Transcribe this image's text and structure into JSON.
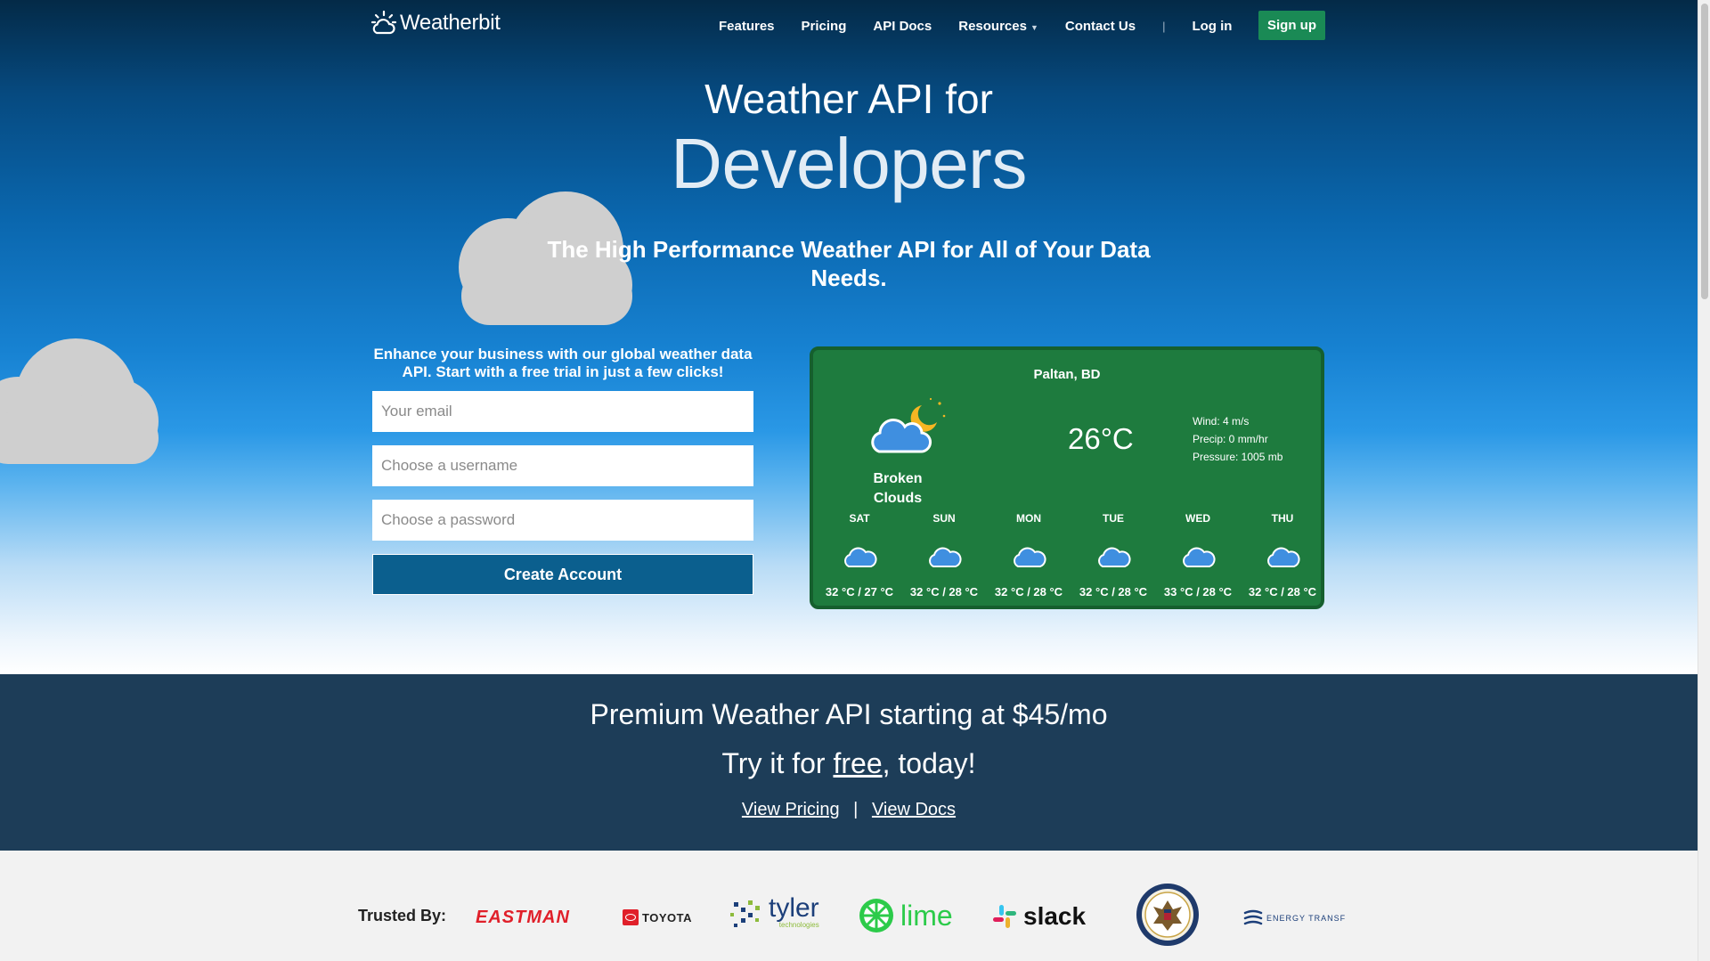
{
  "nav": {
    "brand": "Weatherbit",
    "links": [
      "Features",
      "Pricing",
      "API Docs",
      "Resources",
      "Contact Us"
    ],
    "separator": "|",
    "login": "Log in",
    "signup": "Sign up"
  },
  "hero": {
    "title_line1": "Weather API for",
    "title_line2": "Developers",
    "subtitle": "The High Performance Weather API for All of Your Data Needs."
  },
  "signup_form": {
    "pitch": "Enhance your business with our global weather data API. Start with a free trial in just a few clicks!",
    "email_placeholder": "Your email",
    "username_placeholder": "Choose a username",
    "password_placeholder": "Choose a password",
    "submit_label": "Create Account"
  },
  "weather_widget": {
    "location": "Paltan, BD",
    "condition": "Broken Clouds",
    "temperature": "26°C",
    "wind": "Wind: 4 m/s",
    "precip": "Precip: 0 mm/hr",
    "pressure": "Pressure: 1005 mb",
    "forecast": [
      {
        "day": "SAT",
        "range": "32 °C / 27 °C"
      },
      {
        "day": "SUN",
        "range": "32 °C / 28 °C"
      },
      {
        "day": "MON",
        "range": "32 °C / 28 °C"
      },
      {
        "day": "TUE",
        "range": "32 °C / 28 °C"
      },
      {
        "day": "WED",
        "range": "33 °C / 28 °C"
      },
      {
        "day": "THU",
        "range": "32 °C / 28 °C"
      }
    ]
  },
  "promo": {
    "line1_prefix": "Premium Weather API starting at ",
    "line1_price": "$45/mo",
    "line2_prefix": "Try it for ",
    "line2_link": "free",
    "line2_suffix": ", today!",
    "view_pricing": "View Pricing",
    "separator": "|",
    "view_docs": "View Docs"
  },
  "trusted": {
    "label": "Trusted By:",
    "logos": {
      "eastman": "EASTMAN",
      "toyota": "TOYOTA",
      "tyler": "tyler",
      "tyler_sub": "technologies",
      "lime": "lime",
      "slack": "slack",
      "energy": "ENERGY TRANSF"
    }
  },
  "colors": {
    "signup_green": "#1a8a55",
    "widget_green": "#1e7b3e",
    "create_button": "#0b5f8e",
    "promo_bg": "#1d3d58"
  }
}
